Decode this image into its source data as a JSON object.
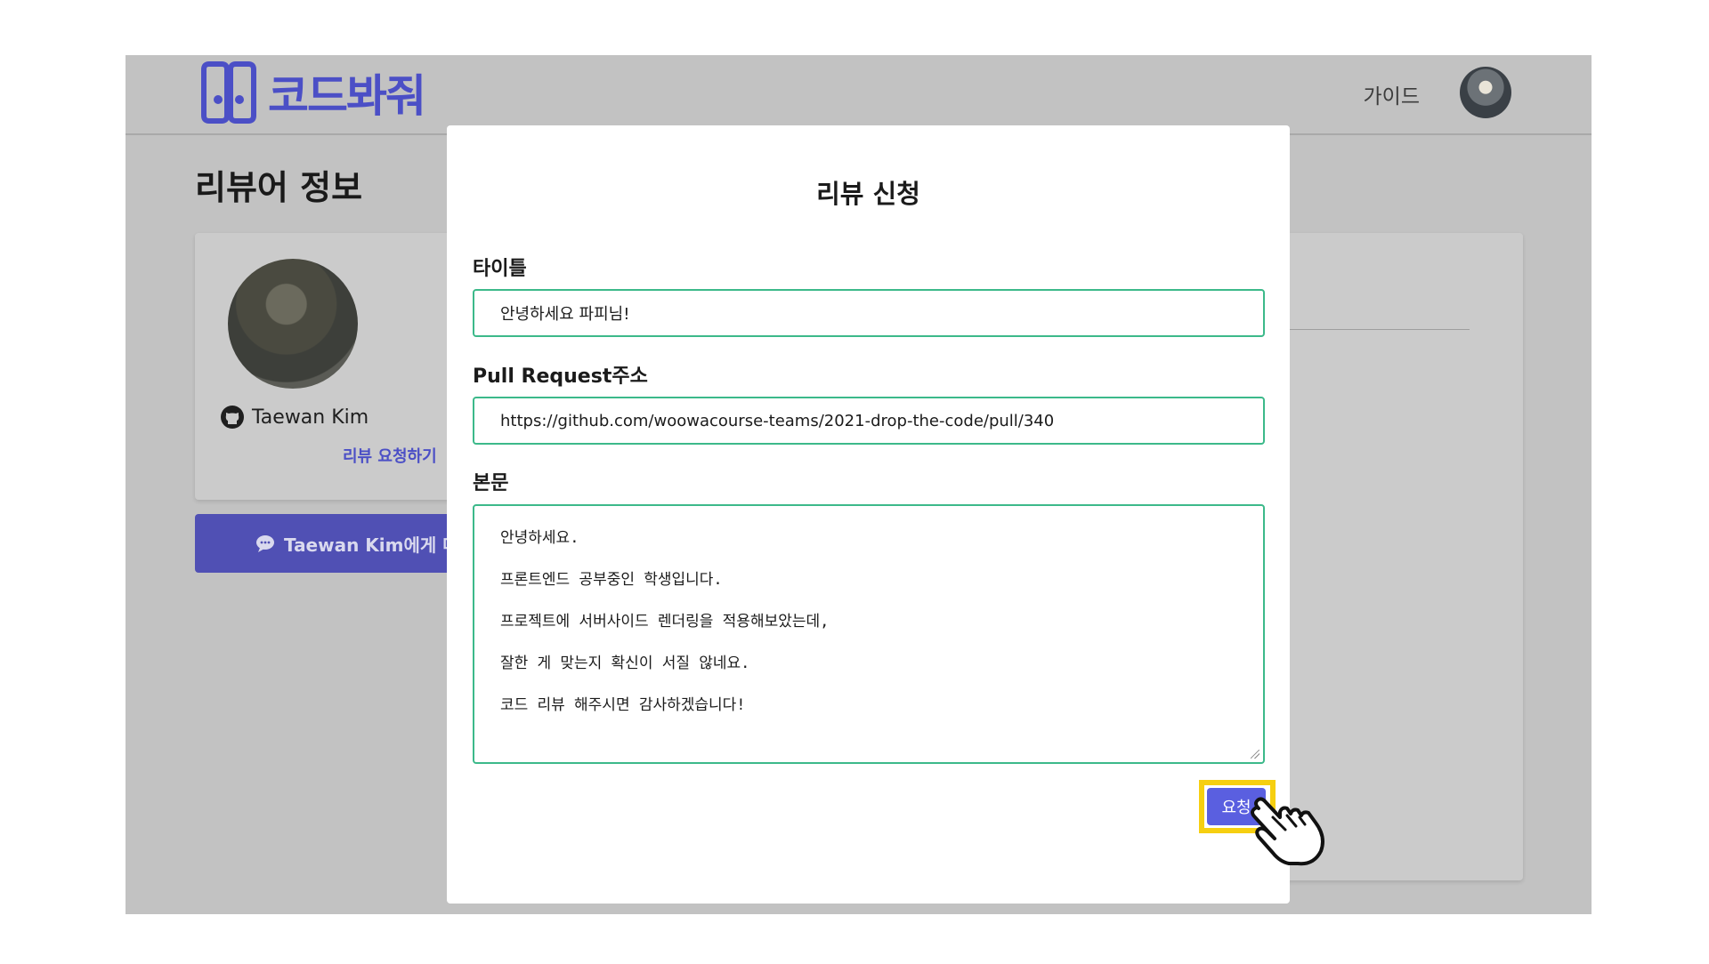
{
  "header": {
    "logo_text": "코드봐줘",
    "guide_link": "가이드",
    "brand_color": "#4b4fc6"
  },
  "profile": {
    "page_title": "리뷰어 정보",
    "reviewer_name": "Taewan Kim",
    "request_link": "리뷰 요청하기",
    "message_button": "Taewan Kim에게 메세"
  },
  "modal": {
    "title": "리뷰 신청",
    "title_label": "타이틀",
    "title_value": "안녕하세요 파피님!",
    "pr_label": "Pull Request주소",
    "pr_value": "https://github.com/woowacourse-teams/2021-drop-the-code/pull/340",
    "body_label": "본문",
    "body_lines": [
      "안녕하세요.",
      "프론트엔드 공부중인 학생입니다.",
      "프로젝트에 서버사이드 렌더링을 적용해보았는데,",
      "잘한 게 맞는지 확신이 서질 않네요.",
      "코드 리뷰 해주시면 감사하겠습니다!"
    ],
    "submit_label": "요청",
    "border_color": "#3cb98a",
    "submit_color": "#5a5fe0",
    "highlight_color": "#f6cf10"
  },
  "icons": {
    "logo": "logo-icon",
    "github": "github-icon",
    "chat": "chat-bubble-icon",
    "cursor": "hand-pointer-icon"
  }
}
